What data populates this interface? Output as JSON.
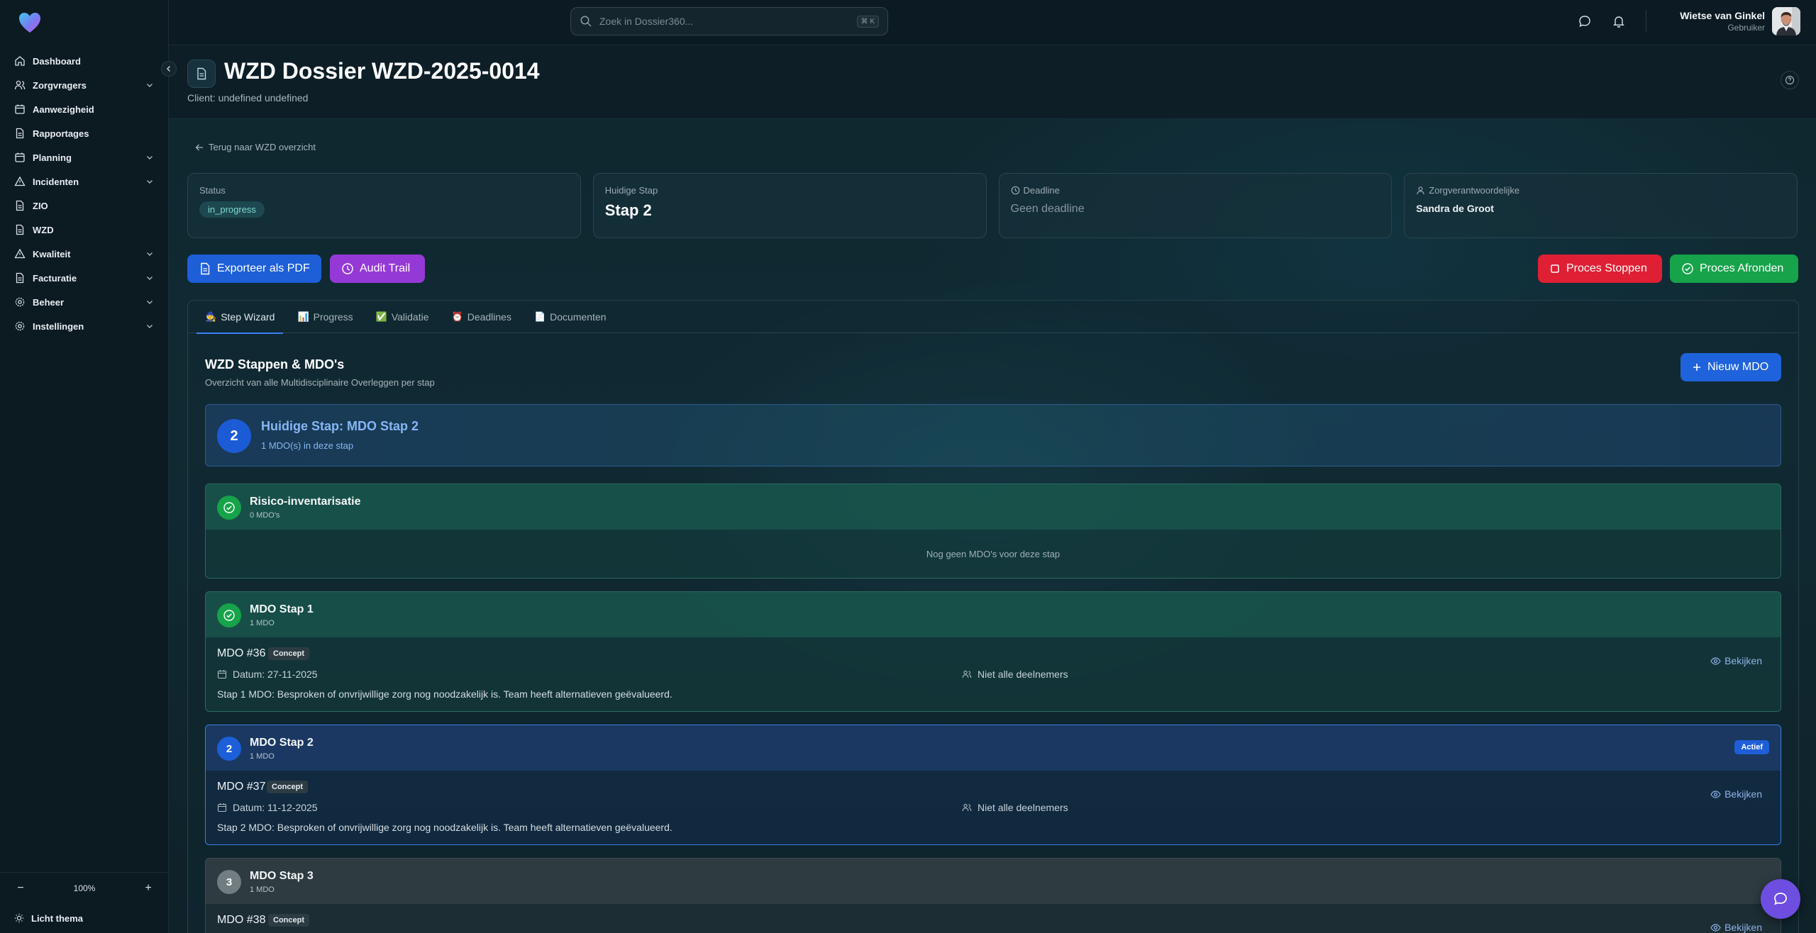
{
  "sidebar": {
    "items": [
      {
        "label": "Dashboard"
      },
      {
        "label": "Zorgvragers"
      },
      {
        "label": "Aanwezigheid"
      },
      {
        "label": "Rapportages"
      },
      {
        "label": "Planning"
      },
      {
        "label": "Incidenten"
      },
      {
        "label": "ZIO"
      },
      {
        "label": "WZD"
      },
      {
        "label": "Kwaliteit"
      },
      {
        "label": "Facturatie"
      },
      {
        "label": "Beheer"
      },
      {
        "label": "Instellingen"
      }
    ],
    "zoom": "100%",
    "zoom_minus": "−",
    "zoom_plus": "+",
    "theme_label": "Licht thema"
  },
  "topbar": {
    "search_placeholder": "Zoek in Dossier360...",
    "search_shortcut": "⌘ K",
    "user_name": "Wietse van Ginkel",
    "user_role": "Gebruiker"
  },
  "header": {
    "title": "WZD Dossier WZD-2025-0014",
    "subtitle": "Client: undefined undefined"
  },
  "main": {
    "back_label": "Terug naar WZD overzicht",
    "stats": {
      "status_label": "Status",
      "status_value": "in_progress",
      "step_label": "Huidige Stap",
      "step_value": "Stap 2",
      "deadline_label": "Deadline",
      "deadline_value": "Geen deadline",
      "owner_label": "Zorgverantwoordelijke",
      "owner_value": "Sandra de Groot"
    },
    "actions": {
      "export_pdf": "Exporteer als PDF",
      "audit_trail": "Audit Trail",
      "stop": "Proces Stoppen",
      "finish": "Proces Afronden"
    },
    "tabs": [
      {
        "emoji": "🧙",
        "label": "Step Wizard"
      },
      {
        "emoji": "📊",
        "label": "Progress"
      },
      {
        "emoji": "✅",
        "label": "Validatie"
      },
      {
        "emoji": "⏰",
        "label": "Deadlines"
      },
      {
        "emoji": "📄",
        "label": "Documenten"
      }
    ],
    "section_title": "WZD Stappen & MDO's",
    "section_subtitle": "Overzicht van alle Multidisciplinaire Overleggen per stap",
    "new_mdo": "Nieuw MDO",
    "current_step": {
      "number": "2",
      "title": "Huidige Stap: MDO Stap 2",
      "count": "1 MDO(s) in deze stap"
    },
    "steps": [
      {
        "name": "Risico-inventarisatie",
        "count": "0 MDO's",
        "empty_message": "Nog geen MDO's voor deze stap"
      },
      {
        "name": "MDO Stap 1",
        "count": "1 MDO",
        "mdo": {
          "number": "MDO #36",
          "badge": "Concept",
          "date": "Datum: 27-11-2025",
          "participants": "Niet alle deelnemers",
          "description": "Stap 1 MDO: Besproken of onvrijwillige zorg nog noodzakelijk is. Team heeft alternatieven geëvalueerd.",
          "view": "Bekijken"
        }
      },
      {
        "badge": "2",
        "name": "MDO Stap 2",
        "count": "1 MDO",
        "active": "Actief",
        "mdo": {
          "number": "MDO #37",
          "badge": "Concept",
          "date": "Datum: 11-12-2025",
          "participants": "Niet alle deelnemers",
          "description": "Stap 2 MDO: Besproken of onvrijwillige zorg nog noodzakelijk is. Team heeft alternatieven geëvalueerd.",
          "view": "Bekijken"
        }
      },
      {
        "badge": "3",
        "name": "MDO Stap 3",
        "count": "1 MDO",
        "mdo": {
          "number": "MDO #38",
          "badge": "Concept",
          "view": "Bekijken"
        }
      }
    ]
  },
  "colors": {
    "primary": "#1e5fd8",
    "purple": "#9539d6",
    "danger": "#df1f34",
    "success": "#16a34a",
    "background": "#0b1a22"
  }
}
